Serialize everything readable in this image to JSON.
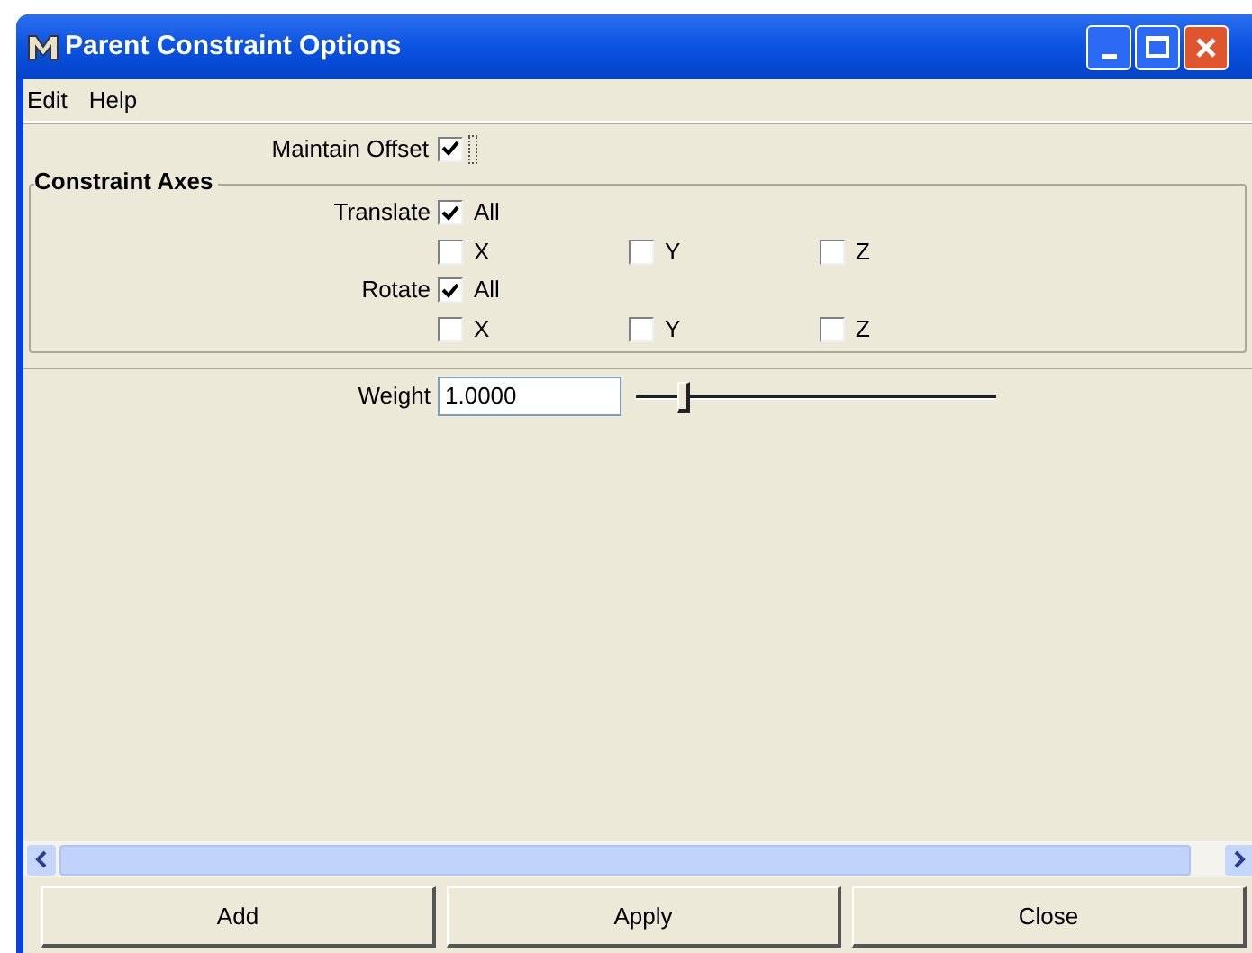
{
  "window": {
    "title": "Parent Constraint Options"
  },
  "menu": [
    "Edit",
    "Help"
  ],
  "maintain_offset": {
    "label": "Maintain Offset",
    "checked": true
  },
  "constraint_axes": {
    "title": "Constraint Axes",
    "groups": [
      {
        "label": "Translate",
        "all": {
          "label": "All",
          "checked": true
        },
        "axes": [
          {
            "label": "X",
            "checked": false
          },
          {
            "label": "Y",
            "checked": false
          },
          {
            "label": "Z",
            "checked": false
          }
        ]
      },
      {
        "label": "Rotate",
        "all": {
          "label": "All",
          "checked": true
        },
        "axes": [
          {
            "label": "X",
            "checked": false
          },
          {
            "label": "Y",
            "checked": false
          },
          {
            "label": "Z",
            "checked": false
          }
        ]
      }
    ]
  },
  "weight": {
    "label": "Weight",
    "value": "1.0000",
    "level": 0.1
  },
  "buttons": [
    "Add",
    "Apply",
    "Close"
  ]
}
